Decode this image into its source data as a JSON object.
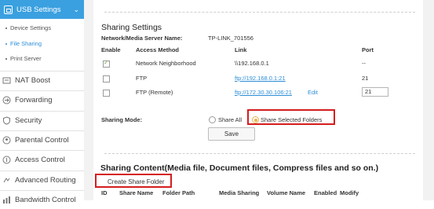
{
  "sidebar": {
    "active_label": "USB Settings",
    "sub_items": [
      "Device Settings",
      "File Sharing",
      "Print Server"
    ],
    "items": [
      {
        "label": "NAT Boost",
        "icon": "nat-icon"
      },
      {
        "label": "Forwarding",
        "icon": "forwarding-icon"
      },
      {
        "label": "Security",
        "icon": "security-icon"
      },
      {
        "label": "Parental Control",
        "icon": "parental-icon"
      },
      {
        "label": "Access Control",
        "icon": "access-icon"
      },
      {
        "label": "Advanced Routing",
        "icon": "routing-icon"
      },
      {
        "label": "Bandwidth Control",
        "icon": "bandwidth-icon"
      }
    ]
  },
  "sharing": {
    "title": "Sharing Settings",
    "server_name_label": "Network/Media Server Name:",
    "server_name_value": "TP-LINK_701556",
    "columns": [
      "Enable",
      "Access Method",
      "Link",
      "Port"
    ],
    "rows": [
      {
        "method": "Network Neighborhood",
        "link": "\\\\192.168.0.1",
        "port": "--",
        "checked": true
      },
      {
        "method": "FTP",
        "link": "ftp://192.168.0.1:21",
        "port": "21",
        "checked": false
      },
      {
        "method": "FTP (Remote)",
        "link": "ftp://172.30.30.106:21",
        "edit": "Edit",
        "port": "21",
        "checked": false
      }
    ],
    "mode_label": "Sharing Mode:",
    "mode_options": [
      "Share All",
      "Share Selected Folders"
    ],
    "selected_mode": "Share Selected Folders",
    "save_label": "Save"
  },
  "content": {
    "title": "Sharing Content(Media file, Document files, Compress files and so on.)",
    "create_label": "Create Share Folder",
    "columns": [
      "ID",
      "Share Name",
      "Folder Path",
      "Media Sharing",
      "Volume Name",
      "Enabled",
      "Modify"
    ]
  },
  "colors": {
    "accent": "#3aa0e0",
    "highlight": "#d51e1e",
    "link": "#2d8ed6",
    "radio_selected": "#e8b34a"
  }
}
